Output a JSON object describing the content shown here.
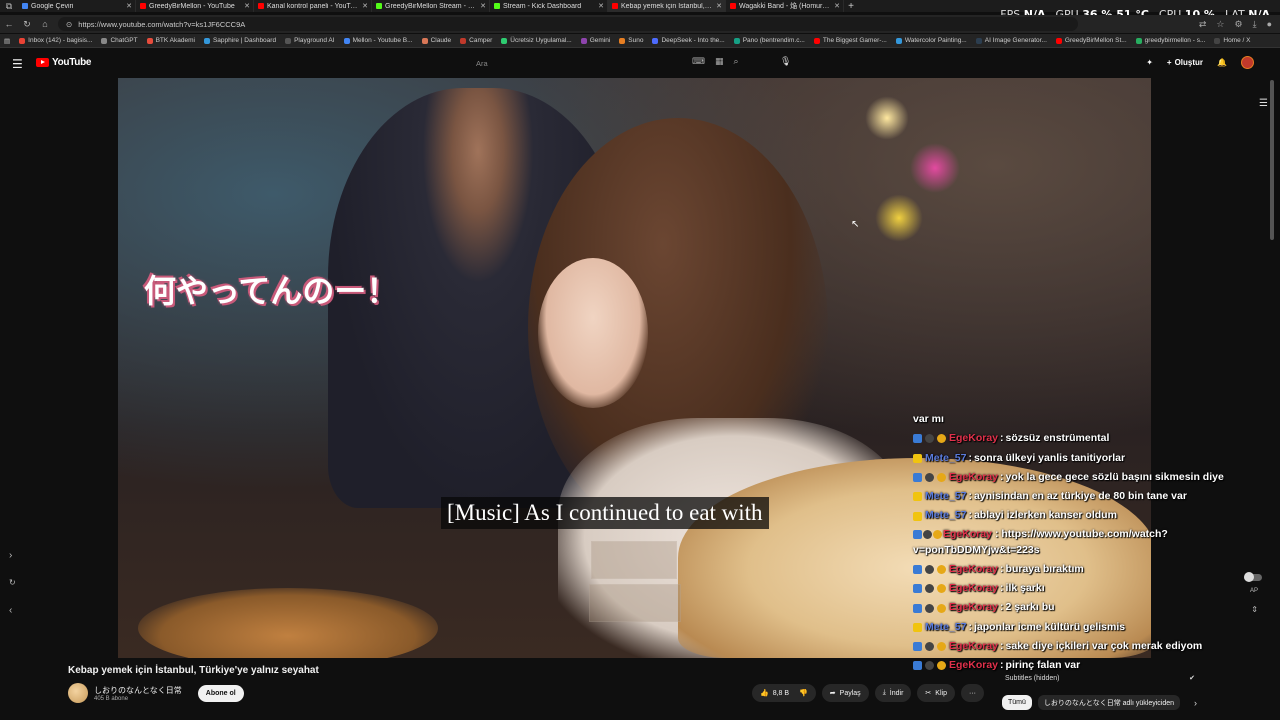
{
  "browser": {
    "tabs": [
      {
        "label": "Google Çeviri",
        "color": "#4285f4",
        "active": false
      },
      {
        "label": "GreedyBirMellon - YouTube",
        "color": "#ff0000",
        "active": false
      },
      {
        "label": "Kanal kontrol paneli - YouTube St",
        "color": "#ff0000",
        "active": false
      },
      {
        "label": "GreedyBirMellon Stream - Watch",
        "color": "#53fc18",
        "active": false
      },
      {
        "label": "Stream - Kick Dashboard",
        "color": "#53fc18",
        "active": false
      },
      {
        "label": "Kebap yemek için İstanbul, Türkiy",
        "color": "#ff0000",
        "active": true
      },
      {
        "label": "Wagakki Band - 焔 (Homura) + B",
        "color": "#ff0000",
        "active": false
      }
    ],
    "new_tab": "+",
    "url": "https://www.youtube.com/watch?v=ks1JF6CCC9A",
    "bookmarks": [
      {
        "label": "Inbox (142) - bagisis...",
        "color": "#ea4335"
      },
      {
        "label": "ChatGPT",
        "color": "#888888"
      },
      {
        "label": "BTK Akademi",
        "color": "#e74c3c"
      },
      {
        "label": "Sapphire | Dashboard",
        "color": "#3498db"
      },
      {
        "label": "Playground AI",
        "color": "#555555"
      },
      {
        "label": "Mellon - Youtube B...",
        "color": "#4285f4"
      },
      {
        "label": "Claude",
        "color": "#d97757"
      },
      {
        "label": "Camper",
        "color": "#c0392b"
      },
      {
        "label": "Ücretsiz Uygulamal...",
        "color": "#2ecc71"
      },
      {
        "label": "Gemini",
        "color": "#8e44ad"
      },
      {
        "label": "Suno",
        "color": "#e67e22"
      },
      {
        "label": "DeepSeek - Into the...",
        "color": "#4d6bfe"
      },
      {
        "label": "Pano (bentrendim.c...",
        "color": "#16a085"
      },
      {
        "label": "The Biggest Gamer-...",
        "color": "#ff0000"
      },
      {
        "label": "Watercolor Painting...",
        "color": "#3498db"
      },
      {
        "label": "AI Image Generator...",
        "color": "#2c3e50"
      },
      {
        "label": "GreedyBirMellon St...",
        "color": "#ff0000"
      },
      {
        "label": "greedybirmellon - s...",
        "color": "#27ae60"
      },
      {
        "label": "Home / X",
        "color": "#444444"
      }
    ]
  },
  "hud": {
    "fps_label": "FPS",
    "fps_value": "N/A",
    "gpu_label": "GPU",
    "gpu_value": "36 %  51 °C",
    "cpu_label": "CPU",
    "cpu_value": "10 %",
    "lat_label": "LAT",
    "lat_value": "N/A"
  },
  "youtube": {
    "logo": "YouTube",
    "search_placeholder": "Ara",
    "create_label": "Oluştur"
  },
  "video": {
    "jp_caption": "何やってんのー！",
    "subtitle": "[Music] As I continued to eat with",
    "title": "Kebap yemek için İstanbul, Türkiye'ye yalnız seyahat",
    "channel_name": "しおりのなんとなく日常",
    "channel_subs": "405 B abone",
    "subscribe_label": "Abone ol",
    "likes": "8,8 B",
    "share_label": "Paylaş",
    "download_label": "İndir",
    "clip_label": "Klip",
    "more_label": "···",
    "subtitles_hidden": "Subtitles (hidden)",
    "autoplay_label": "AP"
  },
  "chat": {
    "header": "var mı",
    "messages": [
      {
        "user": "EgeKoray",
        "text": "sözsüz enstrümental",
        "badges": [
          "blue",
          "dark",
          "gold"
        ],
        "uclass": ""
      },
      {
        "user": "Mete_57",
        "text": "sonra ülkeyi yanlis tanitiyorlar",
        "badges": [
          "yellow"
        ],
        "uclass": "blue"
      },
      {
        "user": "EgeKoray",
        "text": "yok la gece gece sözlü başını sikmesin diye",
        "badges": [
          "blue",
          "dark",
          "gold"
        ],
        "uclass": ""
      },
      {
        "user": "Mete_57",
        "text": "aynisindan en az türkiye de 80 bin tane var",
        "badges": [
          "yellow"
        ],
        "uclass": "blue"
      },
      {
        "user": "Mete_57",
        "text": "ablayi izlerken kanser oldum",
        "badges": [
          "yellow"
        ],
        "uclass": "blue"
      },
      {
        "user": "EgeKoray",
        "text": "https://www.youtube.com/watch?v=ponTbDDMYjw&t=223s",
        "badges": [
          "blue",
          "dark",
          "gold"
        ],
        "uclass": "",
        "wrap": true
      },
      {
        "user": "EgeKoray",
        "text": "buraya bıraktım",
        "badges": [
          "blue",
          "dark",
          "gold"
        ],
        "uclass": ""
      },
      {
        "user": "EgeKoray",
        "text": "ilk şarkı",
        "badges": [
          "blue",
          "dark",
          "gold"
        ],
        "uclass": ""
      },
      {
        "user": "EgeKoray",
        "text": "2 şarkı bu",
        "badges": [
          "blue",
          "dark",
          "gold"
        ],
        "uclass": ""
      },
      {
        "user": "Mete_57",
        "text": "japonlar icme kültürü gelismis",
        "badges": [
          "yellow"
        ],
        "uclass": "blue"
      },
      {
        "user": "EgeKoray",
        "text": "sake diye içkileri var çok merak ediyom",
        "badges": [
          "blue",
          "dark",
          "gold"
        ],
        "uclass": ""
      },
      {
        "user": "EgeKoray",
        "text": "pirinç falan var",
        "badges": [
          "blue",
          "dark",
          "gold"
        ],
        "uclass": ""
      }
    ]
  },
  "chips": {
    "all_label": "Tümü",
    "channel_chip": "しおりのなんとなく日常 adlı yükleyiciden"
  }
}
